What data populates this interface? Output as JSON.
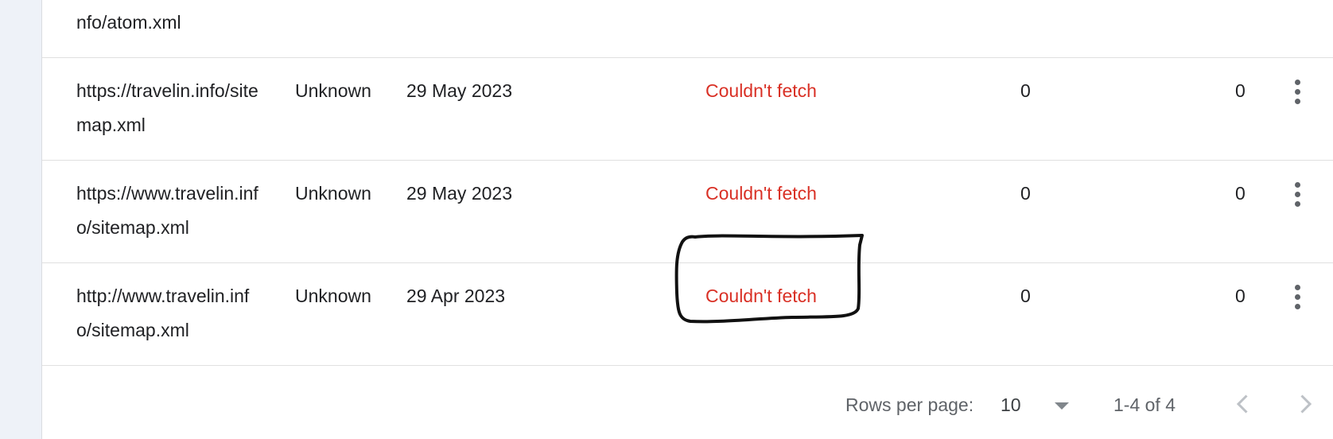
{
  "table": {
    "rows": [
      {
        "url": "nfo/atom.xml"
      },
      {
        "url": "https://travelin.info/sitemap.xml",
        "type": "Unknown",
        "submitted": "29 May 2023",
        "status": "Couldn't fetch",
        "discovered_pages": "0",
        "discovered_videos": "0"
      },
      {
        "url": "https://www.travelin.info/sitemap.xml",
        "type": "Unknown",
        "submitted": "29 May 2023",
        "status": "Couldn't fetch",
        "discovered_pages": "0",
        "discovered_videos": "0"
      },
      {
        "url": "http://www.travelin.info/sitemap.xml",
        "type": "Unknown",
        "submitted": "29 Apr 2023",
        "status": "Couldn't fetch",
        "discovered_pages": "0",
        "discovered_videos": "0"
      }
    ]
  },
  "footer": {
    "rows_per_page_label": "Rows per page:",
    "rows_per_page_value": "10",
    "range_text": "1-4 of 4"
  },
  "colors": {
    "error_status": "#d93025",
    "annotation_stroke": "#111111"
  },
  "icons": [
    "more-vert-icon",
    "dropdown-caret-icon",
    "chevron-left-icon",
    "chevron-right-icon"
  ]
}
